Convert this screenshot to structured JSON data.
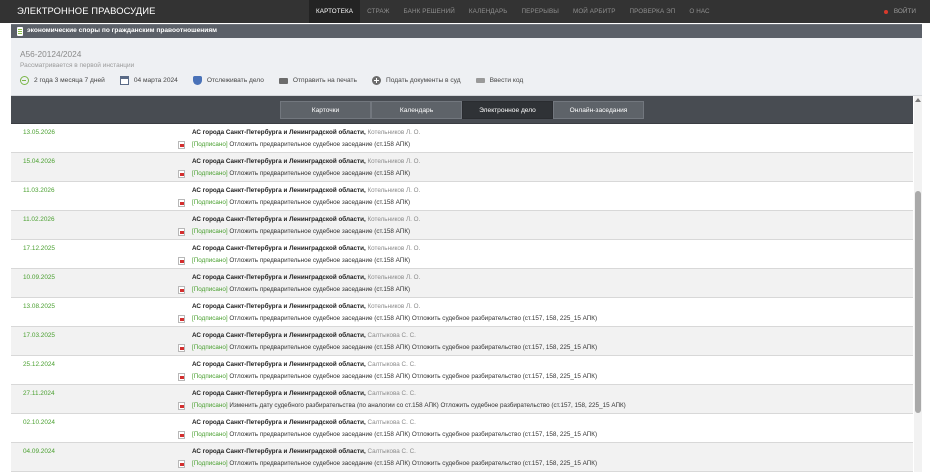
{
  "header": {
    "brand": "ЭЛЕКТРОННОЕ ПРАВОСУДИЕ",
    "nav": [
      {
        "label": "КАРТОТЕКА",
        "active": true
      },
      {
        "label": "СТРАЖ",
        "active": false
      },
      {
        "label": "БАНК РЕШЕНИЙ",
        "active": false
      },
      {
        "label": "КАЛЕНДАРЬ",
        "active": false
      },
      {
        "label": "ПЕРЕРЫВЫ",
        "active": false
      },
      {
        "label": "МОЙ АРБИТР",
        "active": false
      },
      {
        "label": "ПРОВЕРКА ЭП",
        "active": false
      },
      {
        "label": "О НАС",
        "active": false
      }
    ],
    "logout": "ВОЙТИ"
  },
  "category": "экономические споры по гражданским правоотношениям",
  "case": {
    "number": "А56-20124/2024",
    "status": "Рассматривается в первой инстанции",
    "actions": {
      "duration": "2 года 3 месяца 7 дней",
      "date": "04 марта 2024",
      "track": "Отслеживать дело",
      "print": "Отправить на печать",
      "submit": "Подать документы в суд",
      "code": "Ввести код"
    }
  },
  "tabs": [
    {
      "label": "Карточки",
      "active": false
    },
    {
      "label": "Календарь",
      "active": false
    },
    {
      "label": "Электронное дело",
      "active": true
    },
    {
      "label": "Онлайн-заседания",
      "active": false
    }
  ],
  "rows": [
    {
      "date": "13.05.2026",
      "court": "АС города Санкт-Петербурга и Ленинградской области,",
      "judge": "Котельников Л. О.",
      "signed": "[Подписано]",
      "doc": "Отложить предварительное судебное заседание (ст.158 АПК)"
    },
    {
      "date": "15.04.2026",
      "court": "АС города Санкт-Петербурга и Ленинградской области,",
      "judge": "Котельников Л. О.",
      "signed": "[Подписано]",
      "doc": "Отложить предварительное судебное заседание (ст.158 АПК)"
    },
    {
      "date": "11.03.2026",
      "court": "АС города Санкт-Петербурга и Ленинградской области,",
      "judge": "Котельников Л. О.",
      "signed": "[Подписано]",
      "doc": "Отложить предварительное судебное заседание (ст.158 АПК)"
    },
    {
      "date": "11.02.2026",
      "court": "АС города Санкт-Петербурга и Ленинградской области,",
      "judge": "Котельников Л. О.",
      "signed": "[Подписано]",
      "doc": "Отложить предварительное судебное заседание (ст.158 АПК)"
    },
    {
      "date": "17.12.2025",
      "court": "АС города Санкт-Петербурга и Ленинградской области,",
      "judge": "Котельников Л. О.",
      "signed": "[Подписано]",
      "doc": "Отложить предварительное судебное заседание (ст.158 АПК)"
    },
    {
      "date": "10.09.2025",
      "court": "АС города Санкт-Петербурга и Ленинградской области,",
      "judge": "Котельников Л. О.",
      "signed": "[Подписано]",
      "doc": "Отложить предварительное судебное заседание (ст.158 АПК)"
    },
    {
      "date": "13.08.2025",
      "court": "АС города Санкт-Петербурга и Ленинградской области,",
      "judge": "Котельников Л. О.",
      "signed": "[Подписано]",
      "doc": "Отложить предварительное судебное заседание (ст.158 АПК) Отложить судебное разбирательство (ст.157, 158, 225_15 АПК)"
    },
    {
      "date": "17.03.2025",
      "court": "АС города Санкт-Петербурга и Ленинградской области,",
      "judge": "Салтыкова С. С.",
      "signed": "[Подписано]",
      "doc": "Отложить предварительное судебное заседание (ст.158 АПК) Отложить судебное разбирательство (ст.157, 158, 225_15 АПК)"
    },
    {
      "date": "25.12.2024",
      "court": "АС города Санкт-Петербурга и Ленинградской области,",
      "judge": "Салтыкова С. С.",
      "signed": "[Подписано]",
      "doc": "Отложить предварительное судебное заседание (ст.158 АПК) Отложить судебное разбирательство (ст.157, 158, 225_15 АПК)"
    },
    {
      "date": "27.11.2024",
      "court": "АС города Санкт-Петербурга и Ленинградской области,",
      "judge": "Салтыкова С. С.",
      "signed": "[Подписано]",
      "doc": "Изменить дату судебного разбирательства (по аналогии со ст.158 АПК) Отложить судебное разбирательство (ст.157, 158, 225_15 АПК)"
    },
    {
      "date": "02.10.2024",
      "court": "АС города Санкт-Петербурга и Ленинградской области,",
      "judge": "Салтыкова С. С.",
      "signed": "[Подписано]",
      "doc": "Отложить предварительное судебное заседание (ст.158 АПК) Отложить судебное разбирательство (ст.157, 158, 225_15 АПК)"
    },
    {
      "date": "04.09.2024",
      "court": "АС города Санкт-Петербурга и Ленинградской области,",
      "judge": "Салтыкова С. С.",
      "signed": "[Подписано]",
      "doc": "Отложить предварительное судебное заседание (ст.158 АПК) Отложить судебное разбирательство (ст.157, 158, 225_15 АПК)"
    }
  ]
}
